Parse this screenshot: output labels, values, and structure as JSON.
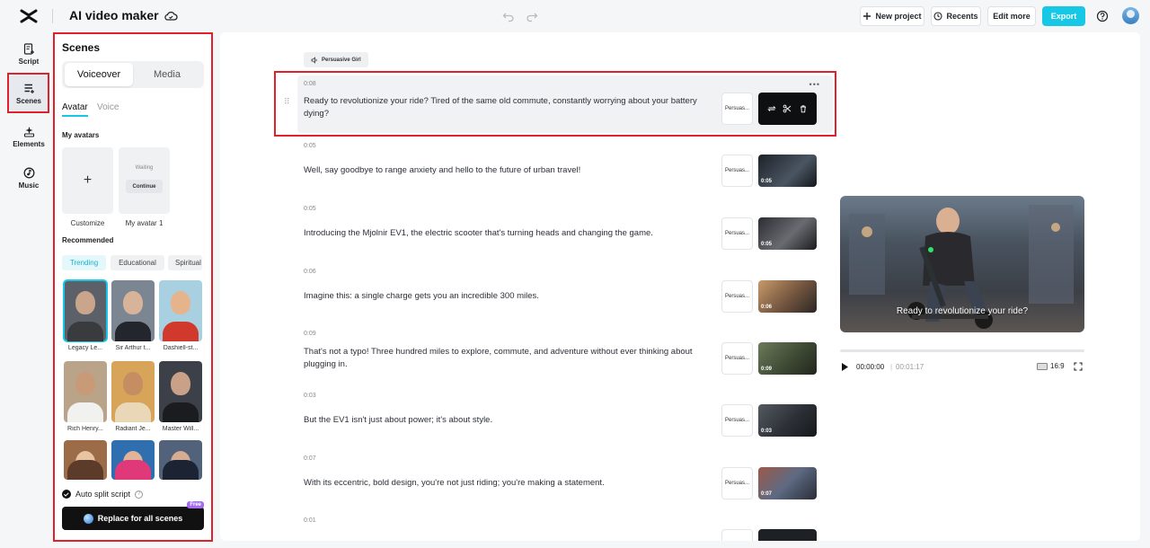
{
  "header": {
    "title": "AI video maker",
    "new_project": "New project",
    "recents": "Recents",
    "edit_more": "Edit more",
    "export": "Export"
  },
  "rail": {
    "items": [
      {
        "label": "Script",
        "icon": "script-icon"
      },
      {
        "label": "Scenes",
        "icon": "scenes-icon",
        "active": true
      },
      {
        "label": "Elements",
        "icon": "elements-icon"
      },
      {
        "label": "Music",
        "icon": "music-icon"
      }
    ]
  },
  "panel": {
    "title": "Scenes",
    "seg": {
      "voiceover": "Voiceover",
      "media": "Media"
    },
    "tabs": {
      "avatar": "Avatar",
      "voice": "Voice"
    },
    "my_avatars_label": "My avatars",
    "customize_plus": "+",
    "customize_label": "Customize",
    "waiting_text": "Waiting",
    "continue_label": "Continue",
    "my_avatar_label": "My avatar 1",
    "recommended_label": "Recommended",
    "chips": [
      "Trending",
      "Educational",
      "Spiritual"
    ],
    "avatars": [
      {
        "name": "Legacy Le...",
        "selected": true
      },
      {
        "name": "Sir Arthur t..."
      },
      {
        "name": "Dashiell-st..."
      },
      {
        "name": "Rich Henry..."
      },
      {
        "name": "Radiant Je..."
      },
      {
        "name": "Master Will..."
      },
      {
        "name": ""
      },
      {
        "name": ""
      },
      {
        "name": ""
      }
    ],
    "auto_split": "Auto split script",
    "replace_btn": "Replace for all scenes",
    "free_badge": "Free"
  },
  "main": {
    "voice_tag": "Persuasive Girl",
    "scenes": [
      {
        "time": "0:08",
        "text": "Ready to revolutionize your ride? Tired of the same old commute, constantly worrying about your battery dying?",
        "voice": "Persuas...",
        "duration": ""
      },
      {
        "time": "0:05",
        "text": "Well, say goodbye to range anxiety and hello to the future of urban travel!",
        "voice": "Persuas...",
        "duration": "0:05"
      },
      {
        "time": "0:05",
        "text": "Introducing the Mjolnir EV1, the electric scooter that's turning heads and changing the game.",
        "voice": "Persuas...",
        "duration": "0:05"
      },
      {
        "time": "0:06",
        "text": "Imagine this: a single charge gets you an incredible 300 miles.",
        "voice": "Persuas...",
        "duration": "0:06"
      },
      {
        "time": "0:09",
        "text": "That's not a typo! Three hundred miles to explore, commute, and adventure without ever thinking about plugging in.",
        "voice": "Persuas...",
        "duration": "0:09"
      },
      {
        "time": "0:03",
        "text": "But the EV1 isn't just about power; it's about style.",
        "voice": "Persuas...",
        "duration": "0:03"
      },
      {
        "time": "0:07",
        "text": "With its eccentric, bold design, you're not just riding; you're making a statement.",
        "voice": "Persuas...",
        "duration": "0:07"
      },
      {
        "time": "0:01",
        "text": "",
        "voice": "",
        "duration": ""
      }
    ]
  },
  "preview": {
    "subtitle": "Ready to revolutionize your ride?",
    "current_time": "00:00:00",
    "separator": "|",
    "total_time": "00:01:17",
    "ratio": "16:9",
    "progress": 0
  },
  "colors": {
    "accent": "#16c8e6",
    "highlight": "#e0202b"
  }
}
